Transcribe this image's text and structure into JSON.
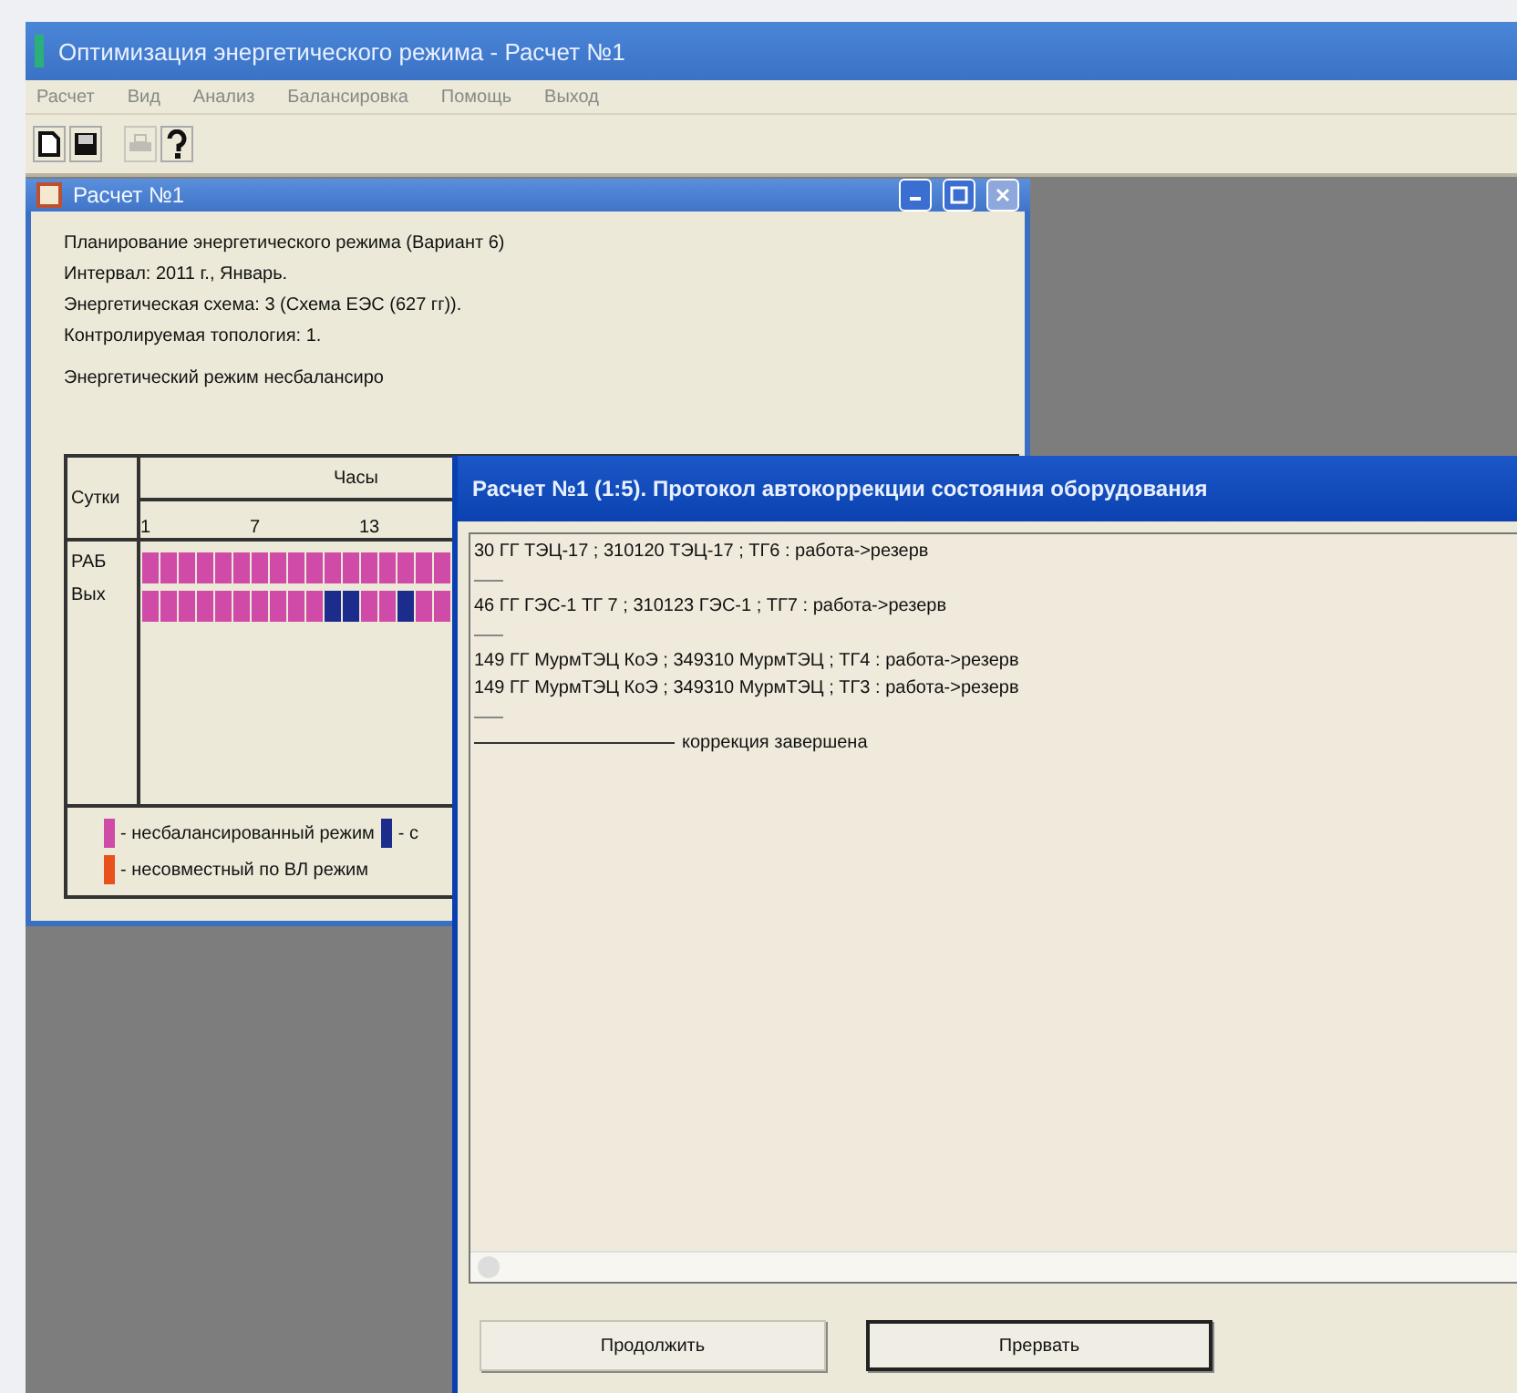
{
  "app": {
    "title": "Оптимизация энергетического режима - Расчет №1",
    "menu": [
      "Расчет",
      "Вид",
      "Анализ",
      "Балансировка",
      "Помощь",
      "Выход"
    ],
    "toolbar": [
      {
        "kind": "new",
        "disabled": false
      },
      {
        "kind": "save",
        "disabled": false
      },
      {
        "kind": "print",
        "disabled": true
      },
      {
        "kind": "help",
        "disabled": false
      }
    ]
  },
  "child_window": {
    "title": "Расчет №1",
    "lines": [
      "Планирование энергетического режима (Вариант 6)",
      "Интервал: 2011 г., Январь.",
      "Энергетическая схема: 3 (Схема ЕЭС (627 гг)).",
      "Контролируемая топология: 1."
    ],
    "status_text": "Энергетический режим несбалансиро",
    "schedule": {
      "day_header": "Сутки",
      "hours_header": "Часы",
      "columns": [
        {
          "label": "1"
        },
        {},
        {},
        {},
        {},
        {},
        {
          "label": "7"
        },
        {},
        {},
        {},
        {},
        {},
        {
          "label": "13"
        },
        {},
        {},
        {},
        {}
      ],
      "rows": [
        {
          "label": "РАБ",
          "cells": [
            {
              "color": "#d04aa8"
            },
            {
              "color": "#d04aa8"
            },
            {
              "color": "#d04aa8"
            },
            {
              "color": "#d04aa8"
            },
            {
              "color": "#d04aa8"
            },
            {
              "color": "#d04aa8"
            },
            {
              "color": "#d04aa8"
            },
            {
              "color": "#d04aa8"
            },
            {
              "color": "#d04aa8"
            },
            {
              "color": "#d04aa8"
            },
            {
              "color": "#d04aa8"
            },
            {
              "color": "#d04aa8"
            },
            {
              "color": "#d04aa8"
            },
            {
              "color": "#d04aa8"
            },
            {
              "color": "#d04aa8"
            },
            {
              "color": "#d04aa8"
            },
            {
              "color": "#d04aa8"
            }
          ]
        },
        {
          "label": "Вых",
          "cells": [
            {
              "color": "#d04aa8"
            },
            {
              "color": "#d04aa8"
            },
            {
              "color": "#d04aa8"
            },
            {
              "color": "#d04aa8"
            },
            {
              "color": "#d04aa8"
            },
            {
              "color": "#d04aa8"
            },
            {
              "color": "#d04aa8"
            },
            {
              "color": "#d04aa8"
            },
            {
              "color": "#d04aa8"
            },
            {
              "color": "#d04aa8"
            },
            {
              "color": "#1c2c8c"
            },
            {
              "color": "#1c2c8c"
            },
            {
              "color": "#d04aa8"
            },
            {
              "color": "#d04aa8"
            },
            {
              "color": "#1c2c8c"
            },
            {
              "color": "#d04aa8"
            },
            {
              "color": "#d04aa8"
            }
          ]
        }
      ],
      "legend": [
        {
          "color": "#d04aa8",
          "text": "- несбалансированный режим"
        },
        {
          "color": "#1c2c8c",
          "text": "- с"
        },
        {
          "color": "#e8501c",
          "text": "- несовместный по ВЛ режим"
        }
      ]
    }
  },
  "dialog": {
    "title": "Расчет №1 (1:5). Протокол автокоррекции состояния оборудования",
    "log": [
      {
        "kind": "text",
        "text": "30 ГГ ТЭЦ-17 ; 310120 ТЭЦ-17 ; ТГ6 : работа->резерв"
      },
      {
        "kind": "separator"
      },
      {
        "kind": "text",
        "text": "46 ГГ ГЭС-1 ТГ 7 ; 310123 ГЭС-1 ; ТГ7 : работа->резерв"
      },
      {
        "kind": "separator"
      },
      {
        "kind": "text",
        "text": "149 ГГ МурмТЭЦ КоЭ ; 349310 МурмТЭЦ ; ТГ4 : работа->резерв"
      },
      {
        "kind": "text",
        "text": "149 ГГ МурмТЭЦ КоЭ ; 349310 МурмТЭЦ ; ТГ3 : работа->резерв"
      },
      {
        "kind": "separator"
      },
      {
        "kind": "end",
        "text": "коррекция завершена"
      }
    ],
    "buttons": [
      {
        "label": "Продолжить",
        "default": false
      },
      {
        "label": "Прервать",
        "default": true
      }
    ]
  }
}
